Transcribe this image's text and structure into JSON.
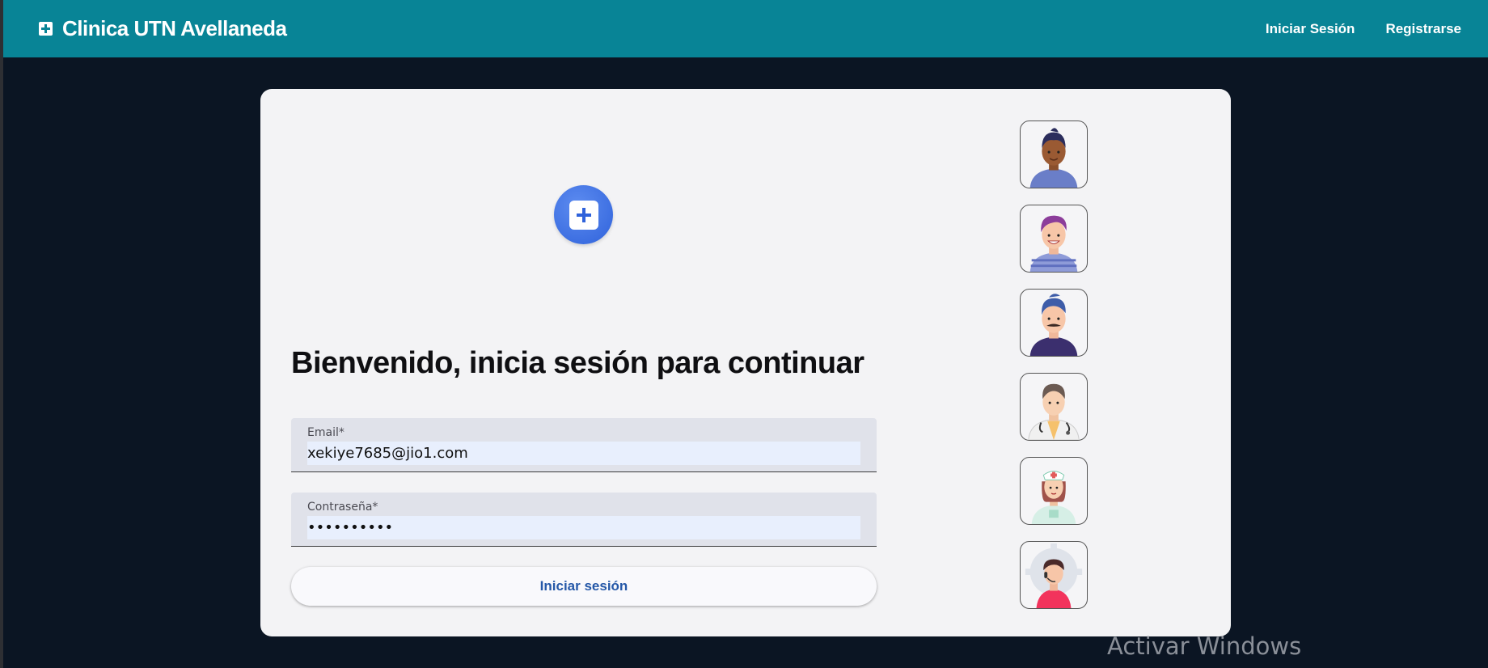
{
  "header": {
    "title": "Clinica UTN Avellaneda",
    "brand_icon": "plus-square-icon",
    "nav": [
      "Iniciar Sesión",
      "Registrarse"
    ]
  },
  "login": {
    "logo_icon": "medical-plus-icon",
    "heading": "Bienvenido, inicia sesión para continuar",
    "email_label": "Email*",
    "email_value": "xekiye7685@jio1.com",
    "password_label": "Contraseña*",
    "password_value": "••••••••••",
    "submit_label": "Iniciar sesión"
  },
  "quick_access_avatars": [
    "patient-avatar-1",
    "patient-avatar-2",
    "patient-avatar-3",
    "doctor-avatar",
    "nurse-avatar",
    "admin-avatar"
  ],
  "colors": {
    "header": "#088496",
    "background": "#0b1523",
    "card": "#f3f3f5",
    "logo": "#2f62db",
    "button_text": "#2558a8"
  },
  "watermark": "Activar Windows"
}
